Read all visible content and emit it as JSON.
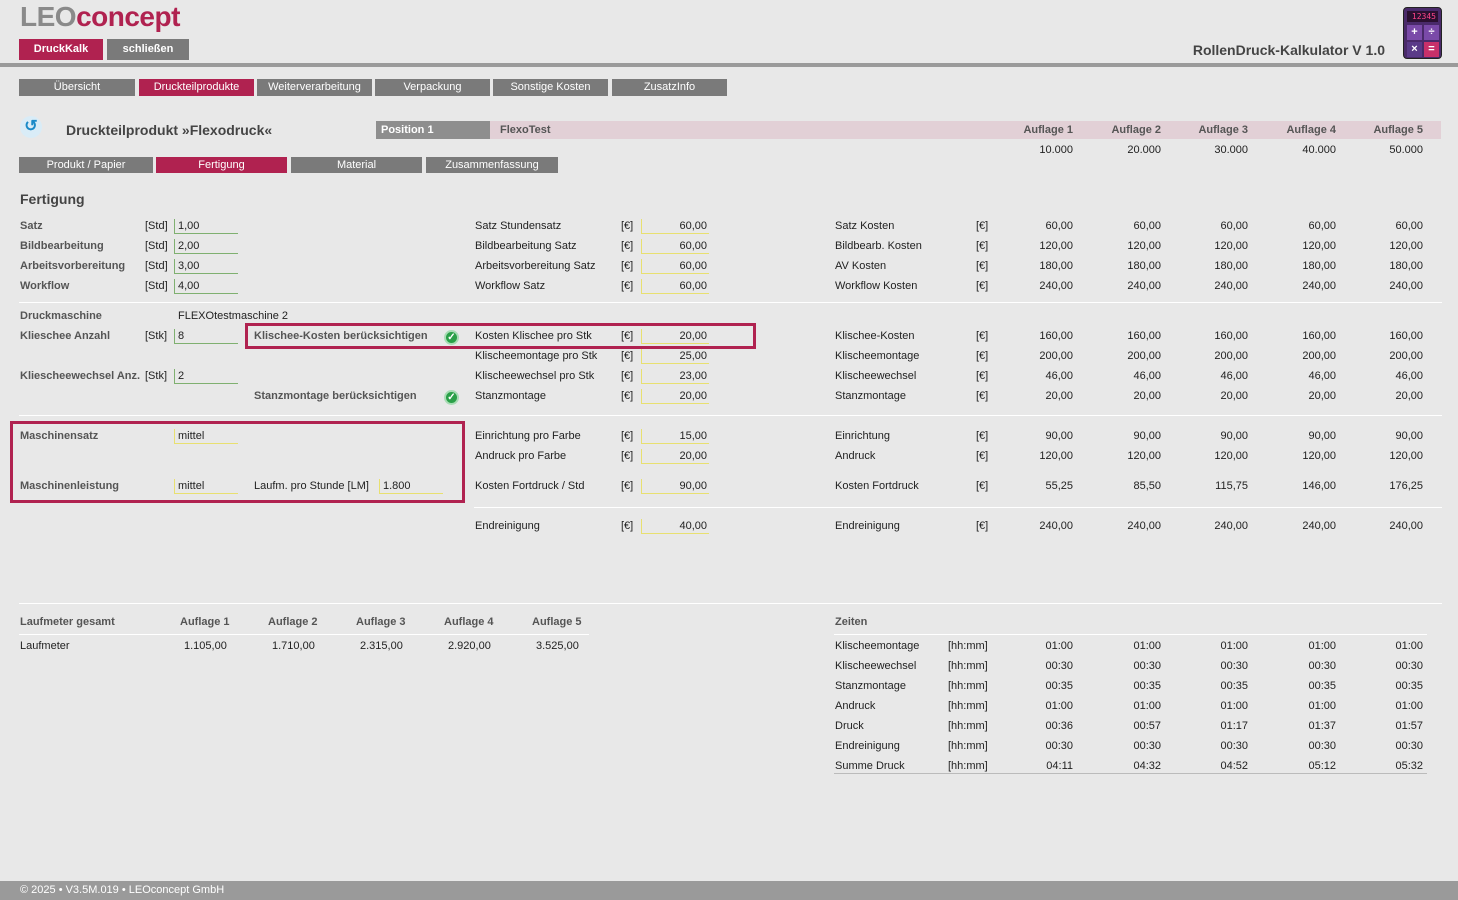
{
  "logo": {
    "leo": "LEO",
    "concept": "concept"
  },
  "topbar": {
    "druckkalk": "DruckKalk",
    "schliessen": "schließen",
    "app_title": "RollenDruck-Kalkulator V 1.0",
    "calc_display": "12345"
  },
  "nav": [
    "Übersicht",
    "Druckteilprodukte",
    "Weiterverarbeitung",
    "Verpackung",
    "Sonstige Kosten",
    "ZusatzInfo"
  ],
  "subnav": [
    "Produkt / Papier",
    "Fertigung",
    "Material",
    "Zusammenfassung"
  ],
  "page_title": "Druckteilprodukt »Flexodruck«",
  "position": {
    "label": "Position 1",
    "name": "FlexoTest"
  },
  "auflagen": {
    "headers": [
      "Auflage 1",
      "Auflage 2",
      "Auflage 3",
      "Auflage 4",
      "Auflage 5"
    ],
    "values": [
      "10.000",
      "20.000",
      "30.000",
      "40.000",
      "50.000"
    ]
  },
  "section_title": "Fertigung",
  "left_rows": [
    {
      "label": "Satz",
      "unit": "[Std]",
      "value": "1,00"
    },
    {
      "label": "Bildbearbeitung",
      "unit": "[Std]",
      "value": "2,00"
    },
    {
      "label": "Arbeitsvorbereitung",
      "unit": "[Std]",
      "value": "3,00"
    },
    {
      "label": "Workflow",
      "unit": "[Std]",
      "value": "4,00"
    }
  ],
  "druckmaschine": {
    "label": "Druckmaschine",
    "value": "FLEXOtestmaschine 2"
  },
  "klischee_anzahl": {
    "label": "Klieschee Anzahl",
    "unit": "[Stk]",
    "value": "8"
  },
  "klischeewechsel_anz": {
    "label": "Kliescheewechsel Anz.",
    "unit": "[Stk]",
    "value": "2"
  },
  "checks": {
    "klischee": "Klischee-Kosten berücksichtigen",
    "stanz": "Stanzmontage berücksichtigen"
  },
  "maschinensatz": {
    "label": "Maschinensatz",
    "value": "mittel"
  },
  "maschinenleistung": {
    "label": "Maschinenleistung",
    "value": "mittel",
    "lm_label": "Laufm. pro Stunde [LM]",
    "lm_value": "1.800"
  },
  "mid_rows": [
    {
      "label": "Satz Stundensatz",
      "unit": "[€]",
      "value": "60,00"
    },
    {
      "label": "Bildbearbeitung Satz",
      "unit": "[€]",
      "value": "60,00"
    },
    {
      "label": "Arbeitsvorbereitung Satz",
      "unit": "[€]",
      "value": "60,00"
    },
    {
      "label": "Workflow Satz",
      "unit": "[€]",
      "value": "60,00"
    },
    {
      "label": "Kosten Klischee pro Stk",
      "unit": "[€]",
      "value": "20,00"
    },
    {
      "label": "Klischeemontage pro Stk",
      "unit": "[€]",
      "value": "25,00"
    },
    {
      "label": "Klischeewechsel pro Stk",
      "unit": "[€]",
      "value": "23,00"
    },
    {
      "label": "Stanzmontage",
      "unit": "[€]",
      "value": "20,00"
    },
    {
      "label": "Einrichtung pro Farbe",
      "unit": "[€]",
      "value": "15,00"
    },
    {
      "label": "Andruck pro Farbe",
      "unit": "[€]",
      "value": "20,00"
    },
    {
      "label": "Kosten Fortdruck / Std",
      "unit": "[€]",
      "value": "90,00"
    },
    {
      "label": "Endreinigung",
      "unit": "[€]",
      "value": "40,00"
    }
  ],
  "cost_rows": [
    {
      "label": "Satz Kosten",
      "unit": "[€]",
      "values": [
        "60,00",
        "60,00",
        "60,00",
        "60,00",
        "60,00"
      ]
    },
    {
      "label": "Bildbearb. Kosten",
      "unit": "[€]",
      "values": [
        "120,00",
        "120,00",
        "120,00",
        "120,00",
        "120,00"
      ]
    },
    {
      "label": "AV Kosten",
      "unit": "[€]",
      "values": [
        "180,00",
        "180,00",
        "180,00",
        "180,00",
        "180,00"
      ]
    },
    {
      "label": "Workflow Kosten",
      "unit": "[€]",
      "values": [
        "240,00",
        "240,00",
        "240,00",
        "240,00",
        "240,00"
      ]
    },
    {
      "label": "Klischee-Kosten",
      "unit": "[€]",
      "values": [
        "160,00",
        "160,00",
        "160,00",
        "160,00",
        "160,00"
      ]
    },
    {
      "label": "Klischeemontage",
      "unit": "[€]",
      "values": [
        "200,00",
        "200,00",
        "200,00",
        "200,00",
        "200,00"
      ]
    },
    {
      "label": "Klischeewechsel",
      "unit": "[€]",
      "values": [
        "46,00",
        "46,00",
        "46,00",
        "46,00",
        "46,00"
      ]
    },
    {
      "label": "Stanzmontage",
      "unit": "[€]",
      "values": [
        "20,00",
        "20,00",
        "20,00",
        "20,00",
        "20,00"
      ]
    },
    {
      "label": "Einrichtung",
      "unit": "[€]",
      "values": [
        "90,00",
        "90,00",
        "90,00",
        "90,00",
        "90,00"
      ]
    },
    {
      "label": "Andruck",
      "unit": "[€]",
      "values": [
        "120,00",
        "120,00",
        "120,00",
        "120,00",
        "120,00"
      ]
    },
    {
      "label": "Kosten Fortdruck",
      "unit": "[€]",
      "values": [
        "55,25",
        "85,50",
        "115,75",
        "146,00",
        "176,25"
      ]
    },
    {
      "label": "Endreinigung",
      "unit": "[€]",
      "values": [
        "240,00",
        "240,00",
        "240,00",
        "240,00",
        "240,00"
      ]
    }
  ],
  "laufmeter": {
    "header": "Laufmeter gesamt",
    "cols": [
      "Auflage 1",
      "Auflage 2",
      "Auflage 3",
      "Auflage 4",
      "Auflage 5"
    ],
    "label": "Laufmeter",
    "values": [
      "1.105,00",
      "1.710,00",
      "2.315,00",
      "2.920,00",
      "3.525,00"
    ]
  },
  "zeiten": {
    "header": "Zeiten",
    "rows": [
      {
        "label": "Klischeemontage",
        "unit": "[hh:mm]",
        "values": [
          "01:00",
          "01:00",
          "01:00",
          "01:00",
          "01:00"
        ]
      },
      {
        "label": "Klischeewechsel",
        "unit": "[hh:mm]",
        "values": [
          "00:30",
          "00:30",
          "00:30",
          "00:30",
          "00:30"
        ]
      },
      {
        "label": "Stanzmontage",
        "unit": "[hh:mm]",
        "values": [
          "00:35",
          "00:35",
          "00:35",
          "00:35",
          "00:35"
        ]
      },
      {
        "label": "Andruck",
        "unit": "[hh:mm]",
        "values": [
          "01:00",
          "01:00",
          "01:00",
          "01:00",
          "01:00"
        ]
      },
      {
        "label": "Druck",
        "unit": "[hh:mm]",
        "values": [
          "00:36",
          "00:57",
          "01:17",
          "01:37",
          "01:57"
        ]
      },
      {
        "label": "Endreinigung",
        "unit": "[hh:mm]",
        "values": [
          "00:30",
          "00:30",
          "00:30",
          "00:30",
          "00:30"
        ]
      },
      {
        "label": "Summe Druck",
        "unit": "[hh:mm]",
        "values": [
          "04:11",
          "04:32",
          "04:52",
          "05:12",
          "05:32"
        ]
      }
    ]
  },
  "footer": "© 2025 • V3.5M.019 • LEOconcept GmbH"
}
